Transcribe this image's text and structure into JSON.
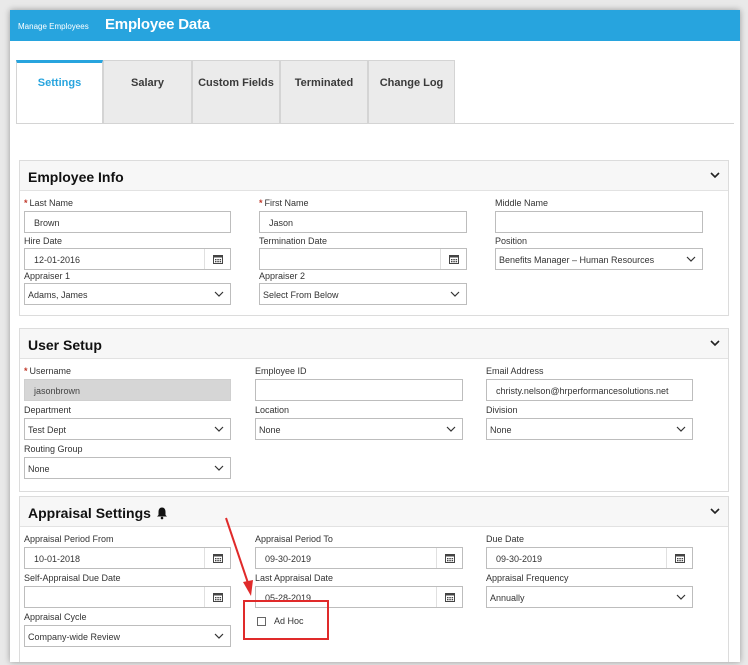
{
  "header": {
    "breadcrumb": "Manage Employees",
    "title": "Employee Data"
  },
  "tabs": [
    {
      "label": "Settings",
      "active": true
    },
    {
      "label": "Salary",
      "active": false
    },
    {
      "label": "Custom Fields",
      "active": false
    },
    {
      "label": "Terminated",
      "active": false
    },
    {
      "label": "Change Log",
      "active": false
    }
  ],
  "employee_info": {
    "title": "Employee Info",
    "last_name": {
      "label": "Last Name",
      "required": true,
      "value": "Brown"
    },
    "first_name": {
      "label": "First Name",
      "required": true,
      "value": "Jason"
    },
    "middle_name": {
      "label": "Middle Name",
      "value": ""
    },
    "hire_date": {
      "label": "Hire Date",
      "value": "12-01-2016"
    },
    "termination_date": {
      "label": "Termination Date",
      "value": ""
    },
    "position": {
      "label": "Position",
      "value": "Benefits Manager – Human Resources"
    },
    "appraiser1": {
      "label": "Appraiser 1",
      "value": "Adams, James"
    },
    "appraiser2": {
      "label": "Appraiser 2",
      "value": "Select From Below"
    }
  },
  "user_setup": {
    "title": "User Setup",
    "username": {
      "label": "Username",
      "required": true,
      "value": "jasonbrown"
    },
    "employee_id": {
      "label": "Employee ID",
      "value": ""
    },
    "email": {
      "label": "Email Address",
      "value": "christy.nelson@hrperformancesolutions.net"
    },
    "department": {
      "label": "Department",
      "value": "Test Dept"
    },
    "location": {
      "label": "Location",
      "value": "None"
    },
    "division": {
      "label": "Division",
      "value": "None"
    },
    "routing_group": {
      "label": "Routing Group",
      "value": "None"
    }
  },
  "appraisal_settings": {
    "title": "Appraisal Settings",
    "period_from": {
      "label": "Appraisal Period From",
      "value": "10-01-2018"
    },
    "period_to": {
      "label": "Appraisal Period To",
      "value": "09-30-2019"
    },
    "due_date": {
      "label": "Due Date",
      "value": "09-30-2019"
    },
    "self_due_date": {
      "label": "Self-Appraisal Due Date",
      "value": ""
    },
    "last_appraisal_date": {
      "label": "Last Appraisal Date",
      "value": "05-28-2019"
    },
    "frequency": {
      "label": "Appraisal Frequency",
      "value": "Annually"
    },
    "cycle": {
      "label": "Appraisal Cycle",
      "value": "Company-wide Review"
    },
    "ad_hoc": {
      "label": "Ad Hoc",
      "checked": false
    }
  },
  "colors": {
    "accent": "#27a4de",
    "annotation": "#e02a2a",
    "required": "#c0392b"
  }
}
